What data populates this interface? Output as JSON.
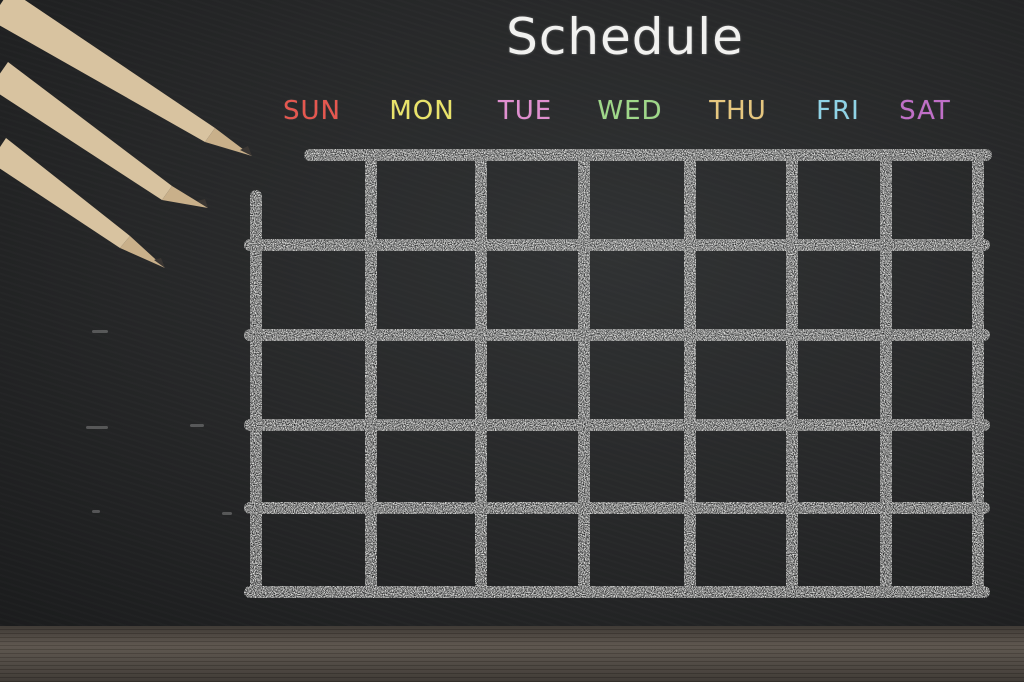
{
  "title": "Schedule",
  "days": [
    {
      "label": "SUN",
      "color": "#e5574f"
    },
    {
      "label": "MON",
      "color": "#e9e36a"
    },
    {
      "label": "TUE",
      "color": "#e08fd0"
    },
    {
      "label": "WED",
      "color": "#9fd889"
    },
    {
      "label": "THU",
      "color": "#e6c77f"
    },
    {
      "label": "FRI",
      "color": "#8fd3e6"
    },
    {
      "label": "SAT",
      "color": "#c06fc8"
    }
  ],
  "colors": {
    "chalk": "#e8e8e6",
    "board": "#2a2b2c",
    "pencil_wood": "#d8c3a0",
    "pencil_lead": "#3a3633"
  }
}
